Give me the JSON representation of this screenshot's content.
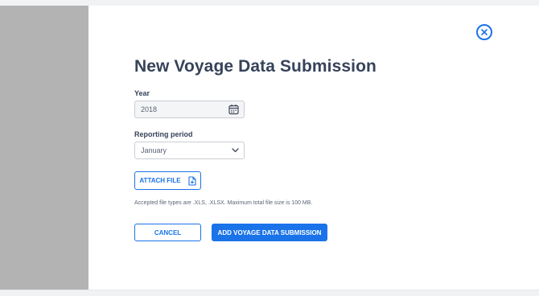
{
  "dialog": {
    "title": "New Voyage Data Submission",
    "close_icon": "close-circle-icon"
  },
  "form": {
    "year": {
      "label": "Year",
      "value": "2018",
      "icon": "calendar-icon"
    },
    "reporting_period": {
      "label": "Reporting period",
      "value": "January",
      "icon": "chevron-down-icon"
    },
    "attach": {
      "label": "ATTACH FILE",
      "icon": "file-add-icon"
    },
    "hint": "Accepted file types are .XLS, .XLSX. Maximum total file size is 100 MB."
  },
  "actions": {
    "cancel_label": "CANCEL",
    "submit_label": "ADD VOYAGE DATA SUBMISSION"
  },
  "colors": {
    "accent": "#1a73e8",
    "title": "#36435a",
    "overlay": "#b3b3b3"
  }
}
